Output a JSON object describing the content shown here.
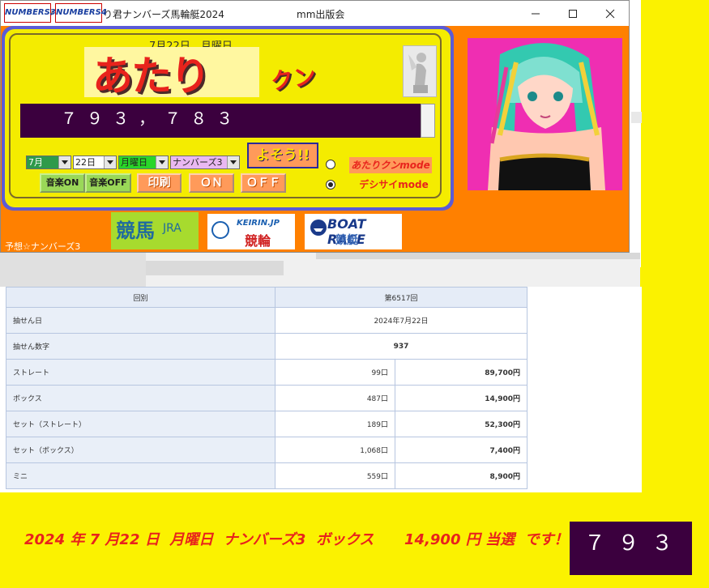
{
  "window": {
    "title": "予想ソフト　あたり君ナンバーズ馬輪艇2024",
    "publisher": "mm出版会"
  },
  "panel": {
    "date_line": "7月22日　月曜日",
    "logo_main": "あたり",
    "logo_sub": "クン",
    "prediction_display": "７ ９ ３ ， ７ ８ ３",
    "selects": {
      "month": "7月",
      "day": "22日",
      "weekday": "月曜日",
      "game": "ナンバーズ3"
    },
    "buttons": {
      "music_on": "音楽ON",
      "music_off": "音楽OFF",
      "print": "印刷",
      "on": "ＯＮ",
      "off": "ＯＦＦ",
      "predict": "よそう!!"
    },
    "modes": {
      "atari": "あたりクンmode",
      "digital": "デシサイmode"
    }
  },
  "logos": {
    "numbers3": "NUMBERS3",
    "numbers4": "NUMBERS4",
    "numbers3_label": "予想☆ナンバーズ3",
    "keiba": "競馬",
    "jra": "JRA",
    "keirin_top": "KEIRIN.JP",
    "keirin": "競輪",
    "boat_top": "BOAT RACE",
    "boat": "競艇"
  },
  "result_table": {
    "header": [
      "回別",
      "第6517回"
    ],
    "draw_date_label": "抽せん日",
    "draw_date": "2024年7月22日",
    "number_label": "抽せん数字",
    "number": "937",
    "rows": [
      {
        "label": "ストレート",
        "count": "99口",
        "amount": "89,700円"
      },
      {
        "label": "ボックス",
        "count": "487口",
        "amount": "14,900円"
      },
      {
        "label": "セット（ストレート）",
        "count": "189口",
        "amount": "52,300円"
      },
      {
        "label": "セット（ボックス）",
        "count": "1,068口",
        "amount": "7,400円"
      },
      {
        "label": "ミニ",
        "count": "559口",
        "amount": "8,900円"
      }
    ]
  },
  "banner": {
    "text": "2024 年 7 月22 日  月曜日  ナンバーズ3  ボックス      14,900 円 当選  です！！",
    "result_display": "７ ９ ３"
  },
  "colors": {
    "background": "#fbf200",
    "window": "#ff8000",
    "display": "#3b003e",
    "accent_red": "#e8231c"
  }
}
